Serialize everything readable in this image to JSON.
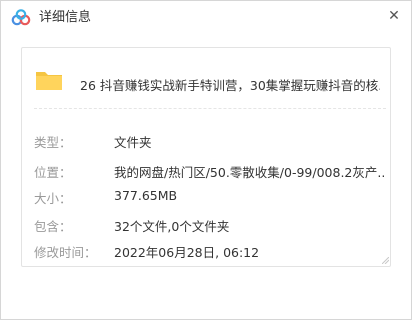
{
  "window": {
    "title": "详细信息",
    "close_glyph": "✕"
  },
  "file": {
    "name": "26 抖音赚钱实战新手特训营，30集掌握玩赚抖音的核...",
    "icon": "folder-icon"
  },
  "details": [
    {
      "label": "类型：",
      "value": "文件夹"
    },
    {
      "label": "位置：",
      "value": "我的网盘/热门区/50.零散收集/0-99/008.2灰产..."
    },
    {
      "label": "大小：",
      "value": "377.65MB"
    },
    {
      "label": "包含：",
      "value": "32个文件,0个文件夹"
    },
    {
      "label": "修改时间：",
      "value": "2022年06月28日, 06:12"
    }
  ],
  "colors": {
    "folder": "#f5c542",
    "label": "#9a9a9a",
    "text": "#333333",
    "logo_blue": "#4a90e2",
    "logo_red": "#e85a5a"
  }
}
